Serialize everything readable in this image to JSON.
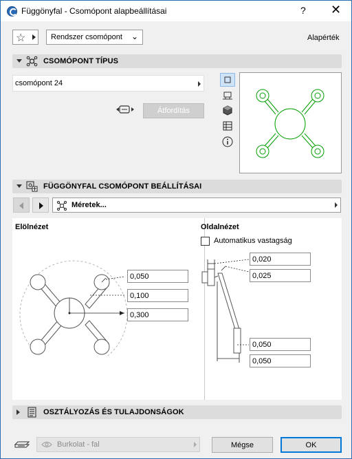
{
  "window": {
    "title": "Függönyfal  - Csomópont alapbeállításai",
    "help": "?",
    "close": "✕"
  },
  "toolbar": {
    "favorites_icon": "star-icon",
    "preset_value": "Rendszer csomópont",
    "default_label": "Alapérték"
  },
  "section_node_type": {
    "label": "CSOMÓPONT TÍPUS",
    "node_value": "csomópont 24",
    "flip_button": "Átfordítás",
    "preview_modes": [
      "plan-view-icon",
      "elevation-icon",
      "3d-view-icon",
      "section-icon",
      "info-icon"
    ],
    "preview_color": "#00a000"
  },
  "section_settings": {
    "label": "FÜGGÖNYFAL CSOMÓPONT BEÁLLÍTÁSAI",
    "page_value": "Méretek...",
    "front_view": {
      "label": "Elölnézet",
      "values": [
        "0,050",
        "0,100",
        "0,300"
      ]
    },
    "side_view": {
      "label": "Oldalnézet",
      "auto_thickness_label": "Automatikus vastagság",
      "auto_thickness_checked": false,
      "values": [
        "0,020",
        "0,025",
        "0,050",
        "0,050"
      ]
    }
  },
  "section_classification": {
    "label": "OSZTÁLYOZÁS ÉS TULAJDONSÁGOK"
  },
  "footer": {
    "surface_value": "Burkolat - fal",
    "cancel_label": "Mégse",
    "ok_label": "OK"
  }
}
